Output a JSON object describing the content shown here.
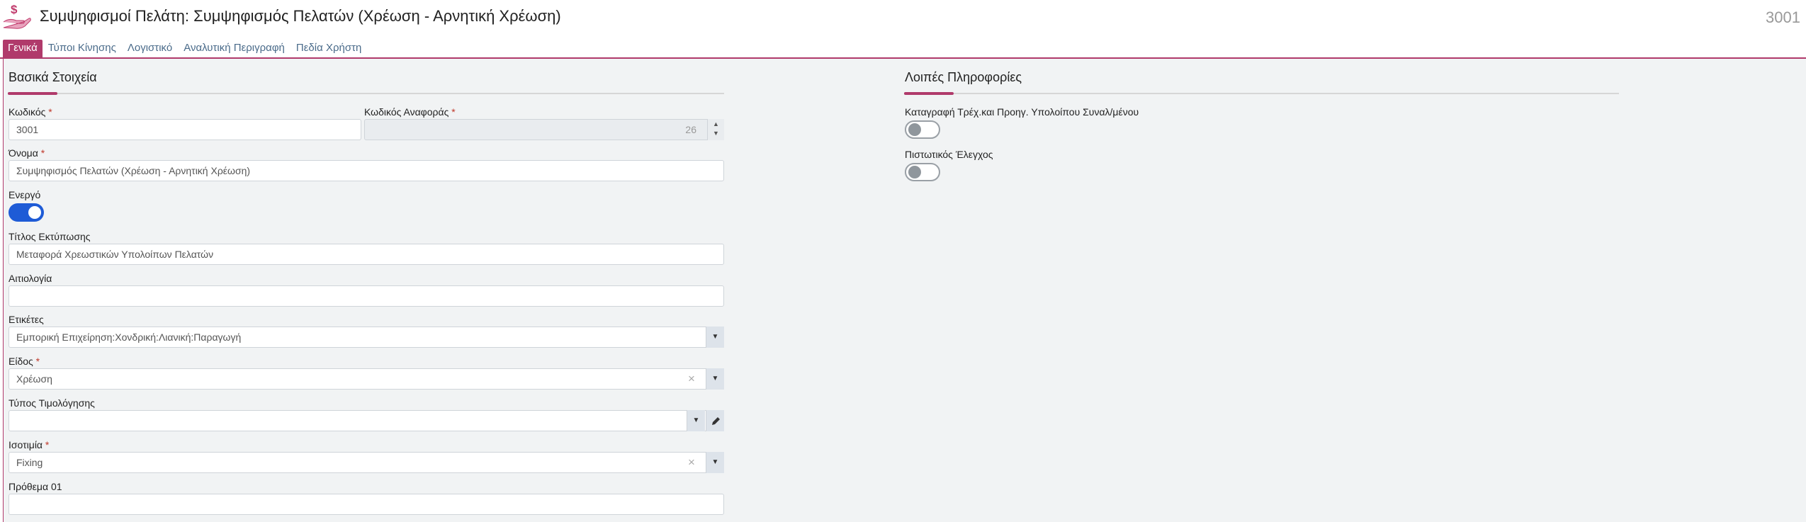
{
  "header": {
    "title": "Συμψηφισμοί Πελάτη: Συμψηφισμός Πελατών (Χρέωση - Αρνητική Χρέωση)",
    "code": "3001",
    "icon": "money-hand-icon"
  },
  "tabs": [
    {
      "label": "Γενικά",
      "active": true
    },
    {
      "label": "Τύποι Κίνησης",
      "active": false
    },
    {
      "label": "Λογιστικό",
      "active": false
    },
    {
      "label": "Αναλυτική Περιγραφή",
      "active": false
    },
    {
      "label": "Πεδία Χρήστη",
      "active": false
    }
  ],
  "left_section": {
    "title": "Βασικά Στοιχεία",
    "code_label": "Κωδικός",
    "code_value": "3001",
    "ref_code_label": "Κωδικός Αναφοράς",
    "ref_code_value": "26",
    "name_label": "Όνομα",
    "name_value": "Συμψηφισμός Πελατών (Χρέωση - Αρνητική Χρέωση)",
    "active_label": "Ενεργό",
    "active_value": true,
    "print_title_label": "Τίτλος Εκτύπωσης",
    "print_title_value": "Μεταφορά Χρεωστικών Υπολοίπων Πελατών",
    "reason_label": "Αιτιολογία",
    "reason_value": "",
    "tags_label": "Ετικέτες",
    "tags_value": "Εμπορική Επιχείρηση:Χονδρική:Λιανική:Παραγωγή",
    "kind_label": "Είδος",
    "kind_value": "Χρέωση",
    "pricing_type_label": "Τύπος Τιμολόγησης",
    "pricing_type_value": "",
    "currency_label": "Ισοτιμία",
    "currency_value": "Fixing",
    "prefix_label": "Πρόθεμα 01",
    "prefix_value": "",
    "required_mark": "*"
  },
  "right_section": {
    "title": "Λοιπές Πληροφορίες",
    "balance_label": "Καταγραφή Τρέχ.και Προηγ. Υπολοίπου Συναλ/μένου",
    "balance_value": false,
    "credit_check_label": "Πιστωτικός Έλεγχος",
    "credit_check_value": false
  },
  "colors": {
    "accent": "#b03a6b",
    "toggle_on": "#1e5bd6",
    "tab_text": "#4a6b8a"
  }
}
